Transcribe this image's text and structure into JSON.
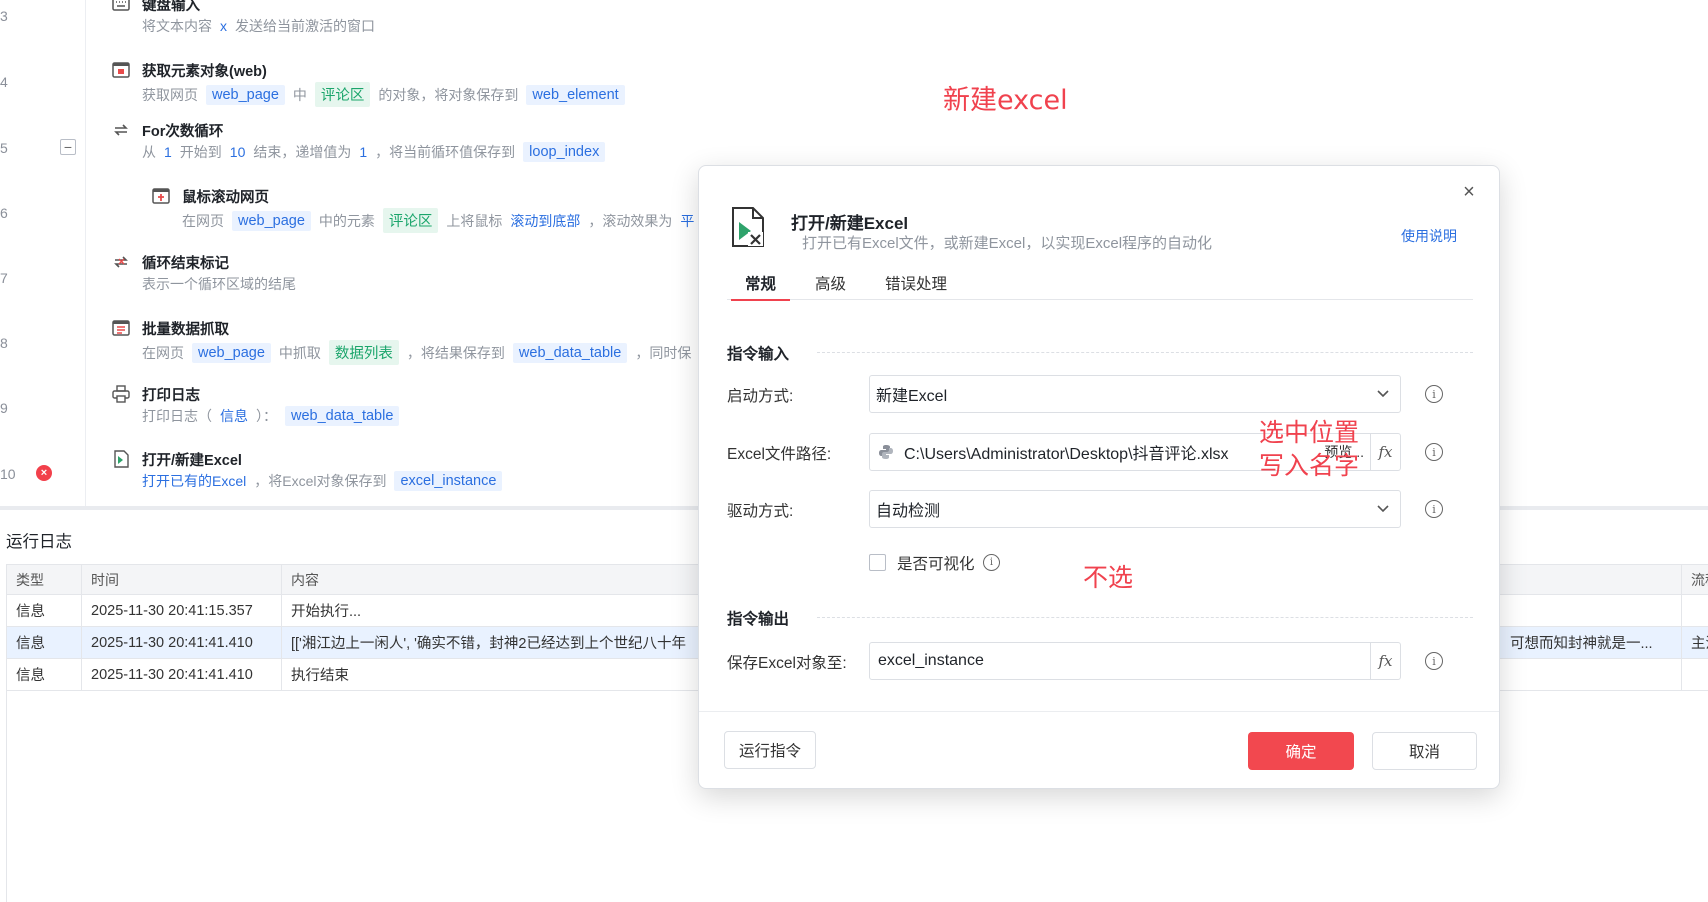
{
  "gutter": {
    "line_numbers": [
      "3",
      "4",
      "5",
      "6",
      "7",
      "8",
      "9",
      "10"
    ],
    "collapse_symbol": "−",
    "error_symbol": "×"
  },
  "steps": {
    "keyboard": {
      "title": "键盘输入",
      "desc_prefix": "将文本内容",
      "desc_var": "x",
      "desc_suffix": "发送给当前激活的窗口"
    },
    "get_element": {
      "title": "获取元素对象(web)",
      "p1": "获取网页",
      "t1": "web_page",
      "p2": "中",
      "t2": "评论区",
      "p3": "的对象，将对象保存到",
      "t3": "web_element"
    },
    "for_loop": {
      "title": "For次数循环",
      "p1": "从",
      "n1": "1",
      "p2": "开始到",
      "n2": "10",
      "p3": "结束，递增值为",
      "n3": "1",
      "p4": "，将当前循环值保存到",
      "t1": "loop_index"
    },
    "scroll": {
      "title": "鼠标滚动网页",
      "p1": "在网页",
      "t1": "web_page",
      "p2": "中的元素",
      "t2": "评论区",
      "p3": "上将鼠标",
      "t3": "滚动到底部",
      "p4": "，滚动效果为",
      "t4": "平"
    },
    "loop_end": {
      "title": "循环结束标记",
      "desc": "表示一个循环区域的结尾"
    },
    "batch": {
      "title": "批量数据抓取",
      "p1": "在网页",
      "t1": "web_page",
      "p2": "中抓取",
      "t2": "数据列表",
      "p3": "，将结果保存到",
      "t3": "web_data_table",
      "p4": "，同时保"
    },
    "print_log": {
      "title": "打印日志",
      "p1": "打印日志（",
      "t1": "信息",
      "p2": "）：",
      "t2": "web_data_table"
    },
    "open_excel": {
      "title": "打开/新建Excel",
      "t1": "打开已有的Excel",
      "p1": "，将Excel对象保存到",
      "t2": "excel_instance"
    }
  },
  "log": {
    "title": "运行日志",
    "columns": [
      "类型",
      "时间",
      "内容",
      "流程"
    ],
    "rows": [
      {
        "type": "信息",
        "time": "2025-11-30 20:41:15.357",
        "content": "开始执行...",
        "content_tail": "",
        "flow": ""
      },
      {
        "type": "信息",
        "time": "2025-11-30 20:41:41.410",
        "content": "[['湘江边上一闲人', '确实不错，封神2已经达到上个世纪八十年",
        "content_tail": "可想而知封神就是一...",
        "flow": "主流"
      },
      {
        "type": "信息",
        "time": "2025-11-30 20:41:41.410",
        "content": "执行结束",
        "content_tail": "",
        "flow": ""
      }
    ]
  },
  "annotations": {
    "new_excel": "新建excel",
    "select_location": "选中位置",
    "write_name": "写入名字",
    "dont_select": "不选"
  },
  "dialog": {
    "close_symbol": "×",
    "title": "打开/新建Excel",
    "subtitle": "打开已有Excel文件，或新建Excel，以实现Excel程序的自动化",
    "help": "使用说明",
    "tabs": [
      "常规",
      "高级",
      "错误处理"
    ],
    "input_section": "指令输入",
    "output_section": "指令输出",
    "start_mode": {
      "label": "启动方式:",
      "value": "新建Excel"
    },
    "file_path": {
      "label": "Excel文件路径:",
      "value": "C:\\Users\\Administrator\\Desktop\\抖音评论.xlsx",
      "browse": "预览..."
    },
    "driver": {
      "label": "驱动方式:",
      "value": "自动检测"
    },
    "visible": {
      "label": "是否可视化"
    },
    "save_to": {
      "label": "保存Excel对象至:",
      "value": "excel_instance"
    },
    "fx": "fx",
    "info": "i",
    "buttons": {
      "run": "运行指令",
      "ok": "确定",
      "cancel": "取消"
    }
  },
  "colors": {
    "accent": "#2b6fe0",
    "primary_button": "#f2484f",
    "annotation": "#f0424e",
    "tag_green": "#1aa56b"
  }
}
